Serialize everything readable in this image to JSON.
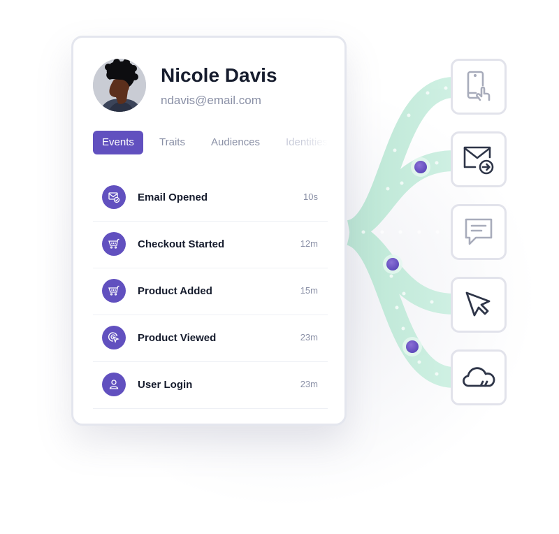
{
  "profile": {
    "name": "Nicole Davis",
    "email": "ndavis@email.com"
  },
  "tabs": [
    {
      "label": "Events",
      "active": true
    },
    {
      "label": "Traits",
      "active": false
    },
    {
      "label": "Audiences",
      "active": false
    },
    {
      "label": "Identities",
      "active": false
    }
  ],
  "events": [
    {
      "label": "Email Opened",
      "time": "10s",
      "icon": "email-check-icon"
    },
    {
      "label": "Checkout Started",
      "time": "12m",
      "icon": "cart-icon"
    },
    {
      "label": "Product Added",
      "time": "15m",
      "icon": "cart-icon"
    },
    {
      "label": "Product Viewed",
      "time": "23m",
      "icon": "target-cursor-icon"
    },
    {
      "label": "User Login",
      "time": "23m",
      "icon": "user-icon"
    }
  ],
  "destinations": [
    {
      "icon": "mobile-tap-icon"
    },
    {
      "icon": "email-send-icon"
    },
    {
      "icon": "chat-message-icon"
    },
    {
      "icon": "cursor-icon"
    },
    {
      "icon": "cloud-icon"
    }
  ],
  "colors": {
    "accent": "#6150bf",
    "flow": "#c4ecdc",
    "text_dark": "#161c2d",
    "text_muted": "#8a90a6"
  }
}
